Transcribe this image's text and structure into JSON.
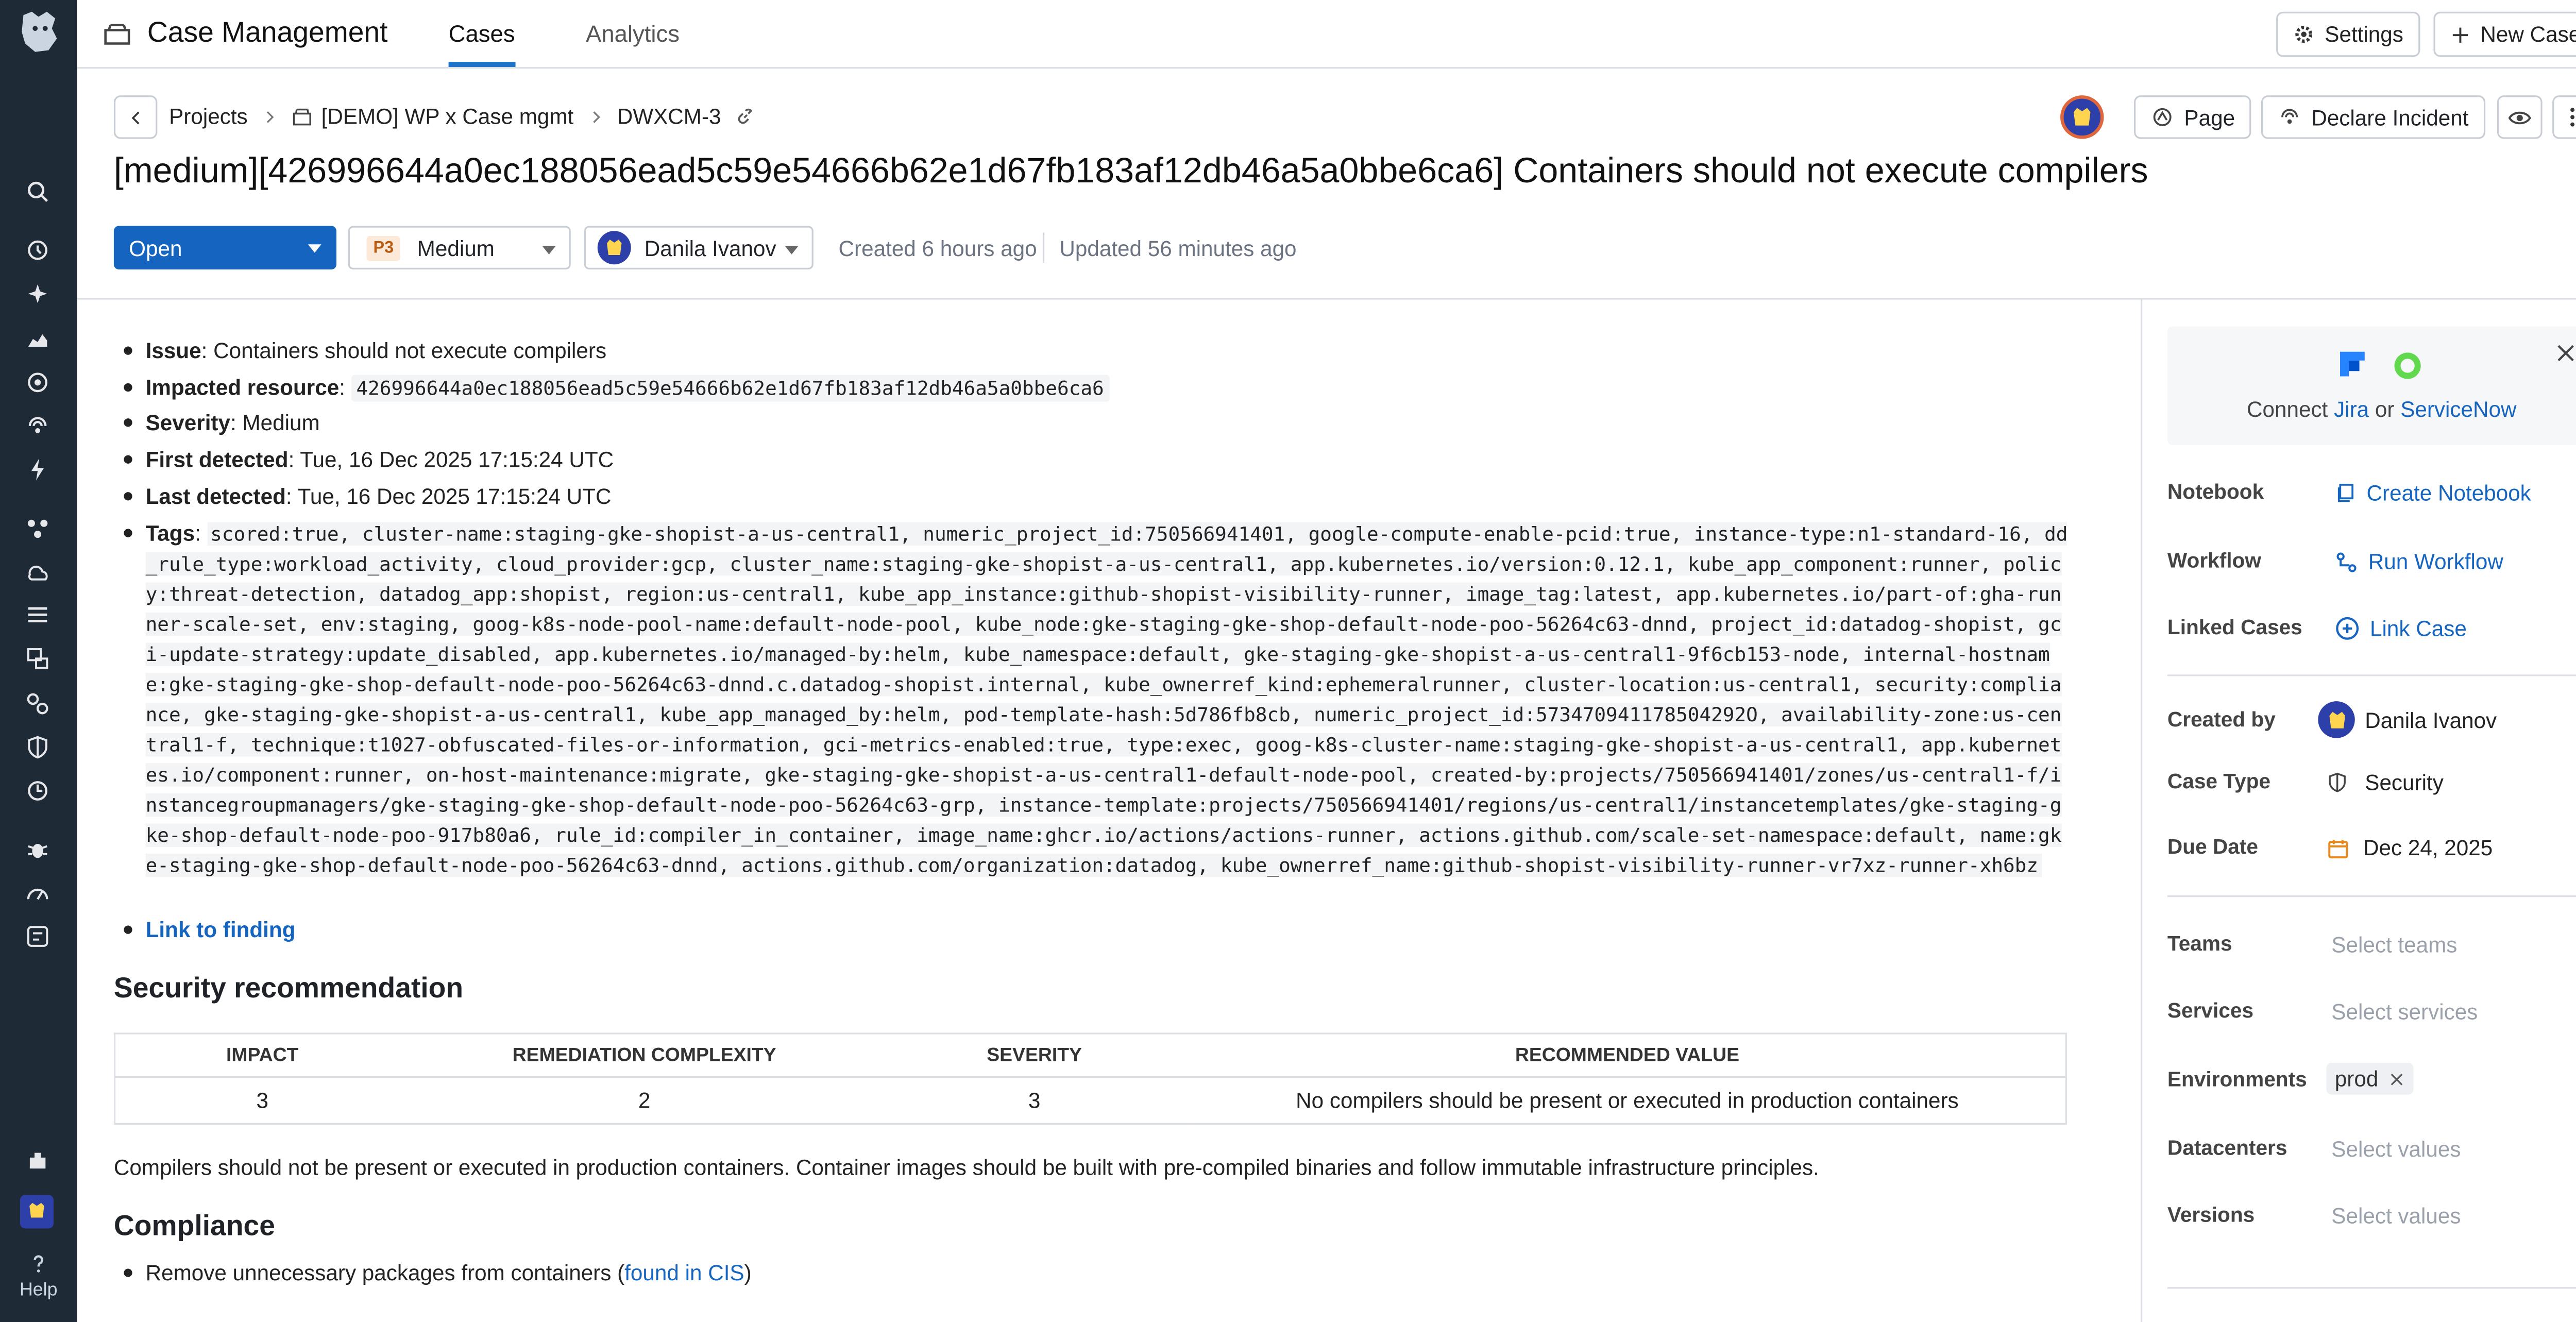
{
  "header": {
    "app_title": "Case Management",
    "tabs": [
      {
        "label": "Cases",
        "active": true
      },
      {
        "label": "Analytics",
        "active": false
      }
    ],
    "settings_label": "Settings",
    "new_case_label": "New Case"
  },
  "nav": {
    "icons": [
      "search-icon",
      "history-icon",
      "sparkle-icon",
      "dashboards-icon",
      "monitors-icon",
      "security-icon",
      "bolt-icon",
      "infrastructure-icon",
      "apm-icon",
      "logs-icon",
      "digital-experience-icon",
      "integrations-icon",
      "security-shield-icon",
      "rum-icon",
      "bug-icon",
      "performance-icon",
      "workflow-icon",
      "extensions-icon"
    ],
    "help_label": "Help"
  },
  "breadcrumb": {
    "items": [
      "Projects",
      "[DEMO] WP x Case mgmt",
      "DWXCM-3"
    ]
  },
  "actions": {
    "page_label": "Page",
    "declare_incident_label": "Declare Incident"
  },
  "case": {
    "title": "[medium][426996644a0ec188056ead5c59e54666b62e1d67fb183af12db46a5a0bbe6ca6] Containers should not execute compilers",
    "status": "Open",
    "priority_badge": "P3",
    "priority": "Medium",
    "assignee": "Danila Ivanov",
    "created": "Created 6 hours ago",
    "updated": "Updated 56 minutes ago"
  },
  "details": {
    "issue_label": "Issue",
    "issue": "Containers should not execute compilers",
    "resource_label": "Impacted resource",
    "resource": "426996644a0ec188056ead5c59e54666b62e1d67fb183af12db46a5a0bbe6ca6",
    "severity_label": "Severity",
    "severity": "Medium",
    "first_label": "First detected",
    "first": "Tue, 16 Dec 2025 17:15:24 UTC",
    "last_label": "Last detected",
    "last": "Tue, 16 Dec 2025 17:15:24 UTC",
    "tags_label": "Tags",
    "tags": "scored:true, cluster-name:staging-gke-shopist-a-us-central1, numeric_project_id:750566941401, google-compute-enable-pcid:true, instance-type:n1-standard-16, dd_rule_type:workload_activity, cloud_provider:gcp, cluster_name:staging-gke-shopist-a-us-central1, app.kubernetes.io/version:0.12.1, kube_app_component:runner, policy:threat-detection, datadog_app:shopist, region:us-central1, kube_app_instance:github-shopist-visibility-runner, image_tag:latest, app.kubernetes.io/part-of:gha-runner-scale-set, env:staging, goog-k8s-node-pool-name:default-node-pool, kube_node:gke-staging-gke-shop-default-node-poo-56264c63-dnnd, project_id:datadog-shopist, gci-update-strategy:update_disabled, app.kubernetes.io/managed-by:helm, kube_namespace:default, gke-staging-gke-shopist-a-us-central1-9f6cb153-node, internal-hostname:gke-staging-gke-shop-default-node-poo-56264c63-dnnd.c.datadog-shopist.internal, kube_ownerref_kind:ephemeralrunner, cluster-location:us-central1, security:compliance, gke-staging-gke-shopist-a-us-central1, kube_app_managed_by:helm, pod-template-hash:5d786fb8cb, numeric_project_id:573470941178504292O, availability-zone:us-central1-f, technique:t1027-obfuscated-files-or-information, gci-metrics-enabled:true, type:exec, goog-k8s-cluster-name:staging-gke-shopist-a-us-central1, app.kubernetes.io/component:runner, on-host-maintenance:migrate, gke-staging-gke-shopist-a-us-central1-default-node-pool, created-by:projects/750566941401/zones/us-central1-f/instancegroupmanagers/gke-staging-gke-shop-default-node-poo-56264c63-grp, instance-template:projects/750566941401/regions/us-central1/instancetemplates/gke-staging-gke-shop-default-node-poo-917b80a6, rule_id:compiler_in_container, image_name:ghcr.io/actions/actions-runner, actions.github.com/scale-set-namespace:default, name:gke-staging-gke-shop-default-node-poo-56264c63-dnnd, actions.github.com/organization:datadog, kube_ownerref_name:github-shopist-visibility-runner-vr7xz-runner-xh6bz",
    "link_label": "Link to finding"
  },
  "recommendation": {
    "heading": "Security recommendation",
    "columns": [
      "IMPACT",
      "REMEDIATION COMPLEXITY",
      "SEVERITY",
      "RECOMMENDED VALUE"
    ],
    "row": [
      "3",
      "2",
      "3",
      "No compilers should be present or executed in production containers"
    ],
    "text": "Compilers should not be present or executed in production containers. Container images should be built with pre-compiled binaries and follow immutable infrastructure principles."
  },
  "compliance": {
    "heading": "Compliance",
    "item_text": "Remove unnecessary packages from containers (",
    "item_link": "found in CIS",
    "item_close": ")"
  },
  "sidebar": {
    "connect_prefix": "Connect ",
    "jira": "Jira",
    "connect_or": " or ",
    "servicenow": "ServiceNow",
    "notebook_label": "Notebook",
    "notebook_action": "Create Notebook",
    "workflow_label": "Workflow",
    "workflow_action": "Run Workflow",
    "linked_label": "Linked Cases",
    "linked_action": "Link Case",
    "created_by_label": "Created by",
    "created_by": "Danila Ivanov",
    "case_type_label": "Case Type",
    "case_type": "Security",
    "due_label": "Due Date",
    "due": "Dec 24, 2025",
    "teams_label": "Teams",
    "teams_ph": "Select teams",
    "services_label": "Services",
    "services_ph": "Select services",
    "env_label": "Environments",
    "env_chip": "prod",
    "dc_label": "Datacenters",
    "dc_ph": "Select values",
    "versions_label": "Versions",
    "versions_ph": "Select values"
  },
  "colors": {
    "nav": "#1f2a37",
    "accent": "#1a73c8",
    "primary": "#1565c0",
    "priority_badge": "#b85c12"
  }
}
